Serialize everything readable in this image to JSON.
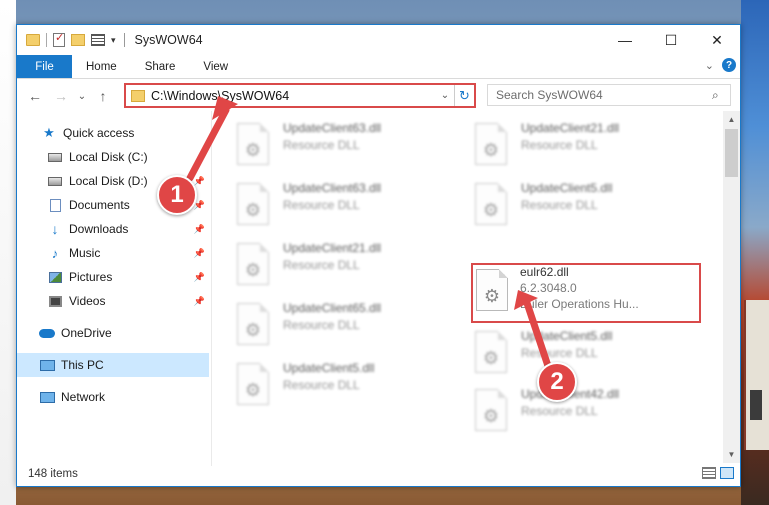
{
  "window": {
    "title": "SysWOW64",
    "controls": {
      "minimize": "—",
      "maximize": "☐",
      "close": "✕"
    }
  },
  "ribbon": {
    "tabs": [
      "File",
      "Home",
      "Share",
      "View"
    ],
    "expand_icon": "⌄",
    "help_label": "?"
  },
  "navigation": {
    "back": "←",
    "forward": "→",
    "recent": "⌄",
    "up": "↑",
    "address": "C:\\Windows\\SysWOW64",
    "address_dropdown": "⌄",
    "refresh": "↻",
    "search_placeholder": "Search SysWOW64",
    "search_icon": "⌕"
  },
  "sidebar": {
    "items": [
      {
        "label": "Quick access",
        "icon": "star-icon",
        "pinned": false
      },
      {
        "label": "Local Disk (C:)",
        "icon": "disk-icon",
        "pinned": false
      },
      {
        "label": "Local Disk (D:)",
        "icon": "disk-icon",
        "pinned": true
      },
      {
        "label": "Documents",
        "icon": "document-icon",
        "pinned": true
      },
      {
        "label": "Downloads",
        "icon": "download-icon",
        "pinned": true
      },
      {
        "label": "Music",
        "icon": "music-icon",
        "pinned": true
      },
      {
        "label": "Pictures",
        "icon": "pictures-icon",
        "pinned": true
      },
      {
        "label": "Videos",
        "icon": "video-icon",
        "pinned": true
      },
      {
        "label": "OneDrive",
        "icon": "cloud-icon",
        "pinned": false
      },
      {
        "label": "This PC",
        "icon": "computer-icon",
        "pinned": false,
        "selected": true
      },
      {
        "label": "Network",
        "icon": "network-icon",
        "pinned": false
      }
    ],
    "pin_glyph": "📌"
  },
  "files": [
    {
      "name": "UpdateClient63.dll",
      "type": "Resource DLL"
    },
    {
      "name": "UpdateClient21.dll",
      "type": "Resource DLL"
    },
    {
      "name": "UpdateClient63.dll",
      "type": "Resource DLL"
    },
    {
      "name": "UpdateClient5.dll",
      "type": "Resource DLL"
    },
    {
      "name": "UpdateClient21.dll",
      "type": "Resource DLL"
    },
    {
      "name": "eulr62.dll",
      "version": "6.2.3048.0",
      "type": "Euler Operations Hu...",
      "highlighted": true
    },
    {
      "name": "UpdateClient65.dll",
      "type": "Resource DLL"
    },
    {
      "name": "UpdateClient5.dll",
      "type": "Resource DLL"
    },
    {
      "name": "UpdateClient5.dll",
      "type": "Resource DLL"
    },
    {
      "name": "UpdateClient42.dll",
      "type": "Resource DLL"
    }
  ],
  "status": {
    "item_count": "148 items"
  },
  "annotations": {
    "badge_1": "1",
    "badge_2": "2",
    "highlight_color": "#d94a4a"
  },
  "colors": {
    "accent": "#1979ca",
    "selected_bg": "#cce8ff"
  }
}
